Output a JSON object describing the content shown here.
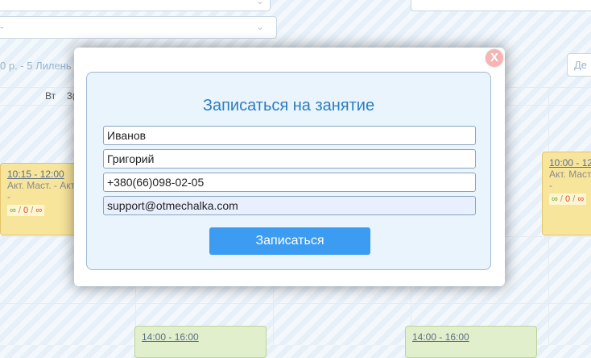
{
  "background": {
    "top_select_left_text": "",
    "price_text": "0 р. - 5 Лилень",
    "weekday_label": "Вт",
    "weekday_label_2": "3(",
    "day_button_label": "Де",
    "events": [
      {
        "time": "10:15 - 12:00",
        "desc": "Акт. Маст. - Акт",
        "dash": "-",
        "counts": {
          "a": "∞",
          "b": "0",
          "c": "∞"
        }
      },
      {
        "time": "10:00 - 12",
        "desc": "Акт. Маст",
        "dash": "-",
        "counts": {
          "a": "∞",
          "b": "0",
          "c": "∞"
        }
      },
      {
        "time": "14:00 - 16:00"
      },
      {
        "time": "14:00 - 16:00"
      }
    ]
  },
  "modal": {
    "title": "Записаться на занятие",
    "close_label": "X",
    "fields": {
      "last_name": "Иванов",
      "first_name": "Григорий",
      "phone": "+380(66)098-02-05",
      "email": "support@otmechalka.com"
    },
    "submit_label": "Записаться"
  },
  "colors": {
    "accent": "#3b9cf2",
    "title": "#2a7dc0",
    "close": "#f5b5b5"
  }
}
